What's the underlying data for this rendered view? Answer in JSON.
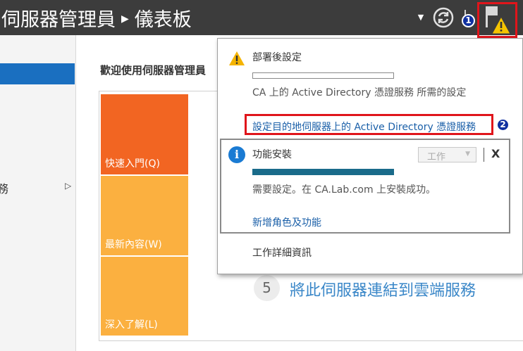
{
  "header": {
    "title_part1": "伺服器管理員",
    "title_part2": "儀表板",
    "badge1": "1",
    "badge2": "2"
  },
  "sidebar": {
    "item_label": "務"
  },
  "main": {
    "welcome_heading": "歡迎使用伺服器管理員",
    "tiles": [
      {
        "label": "快速入門(Q)"
      },
      {
        "label": "最新內容(W)"
      },
      {
        "label": "深入了解(L)"
      }
    ],
    "step5_number": "5",
    "step5_text": "將此伺服器連結到雲端服務"
  },
  "notifications": {
    "n1": {
      "title": "部署後設定",
      "description": "CA 上的 Active Directory 憑證服務 所需的設定",
      "link": "設定目的地伺服器上的 Active Directory 憑證服務"
    },
    "n2": {
      "title": "功能安裝",
      "task_select": "工作",
      "close": "X",
      "description": "需要設定。在 CA.Lab.com 上安裝成功。",
      "link": "新增角色及功能",
      "progress": 1.0
    },
    "task_details": "工作詳細資訊"
  },
  "colors": {
    "header_bg": "#3c3c3c",
    "tile_primary": "#f26522",
    "tile_secondary": "#fbb040",
    "link": "#1a5fa8",
    "highlight_red": "#e0151b",
    "progress_fill": "#1a6b8a",
    "nav_selected": "#1a6fc0"
  },
  "icons": {
    "refresh": "refresh-icon",
    "flag": "notification-flag-icon",
    "warning": "warning-icon",
    "info": "info-icon"
  }
}
